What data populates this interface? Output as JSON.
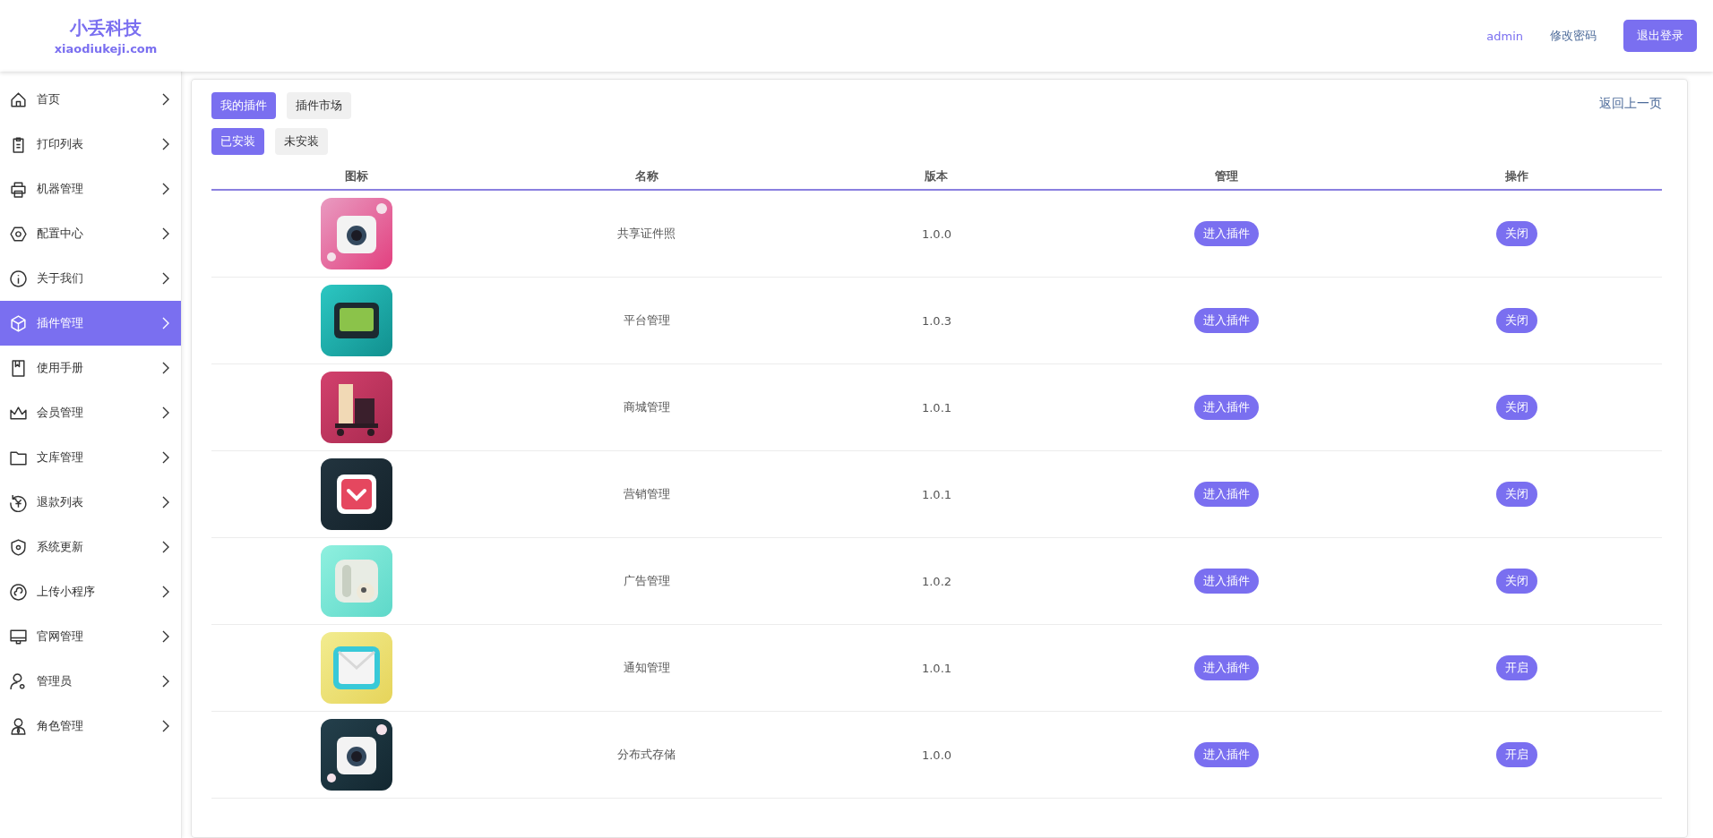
{
  "header": {
    "logo_title": "小丢科技",
    "logo_subtitle": "xiaodiukeji.com",
    "user": "admin",
    "change_password": "修改密码",
    "logout": "退出登录"
  },
  "sidebar": {
    "items": [
      {
        "label": "首页",
        "selected": false
      },
      {
        "label": "打印列表",
        "selected": false
      },
      {
        "label": "机器管理",
        "selected": false
      },
      {
        "label": "配置中心",
        "selected": false
      },
      {
        "label": "关于我们",
        "selected": false
      },
      {
        "label": "插件管理",
        "selected": true
      },
      {
        "label": "使用手册",
        "selected": false
      },
      {
        "label": "会员管理",
        "selected": false
      },
      {
        "label": "文库管理",
        "selected": false
      },
      {
        "label": "退款列表",
        "selected": false
      },
      {
        "label": "系统更新",
        "selected": false
      },
      {
        "label": "上传小程序",
        "selected": false
      },
      {
        "label": "官网管理",
        "selected": false
      },
      {
        "label": "管理员",
        "selected": false
      },
      {
        "label": "角色管理",
        "selected": false
      }
    ]
  },
  "tabs": [
    {
      "label": "我的插件",
      "selected": true
    },
    {
      "label": "插件市场",
      "selected": false
    }
  ],
  "filters": [
    {
      "label": "已安装",
      "selected": true
    },
    {
      "label": "未安装",
      "selected": false
    }
  ],
  "back_link": "返回上一页",
  "table": {
    "columns": [
      "图标",
      "名称",
      "版本",
      "管理",
      "操作"
    ],
    "rows": [
      {
        "name": "共享证件照",
        "version": "1.0.0",
        "manage": "进入插件",
        "action": "关闭"
      },
      {
        "name": "平台管理",
        "version": "1.0.3",
        "manage": "进入插件",
        "action": "关闭"
      },
      {
        "name": "商城管理",
        "version": "1.0.1",
        "manage": "进入插件",
        "action": "关闭"
      },
      {
        "name": "营销管理",
        "version": "1.0.1",
        "manage": "进入插件",
        "action": "关闭"
      },
      {
        "name": "广告管理",
        "version": "1.0.2",
        "manage": "进入插件",
        "action": "关闭"
      },
      {
        "name": "通知管理",
        "version": "1.0.1",
        "manage": "进入插件",
        "action": "开启"
      },
      {
        "name": "分布式存储",
        "version": "1.0.0",
        "manage": "进入插件",
        "action": "开启"
      }
    ]
  }
}
